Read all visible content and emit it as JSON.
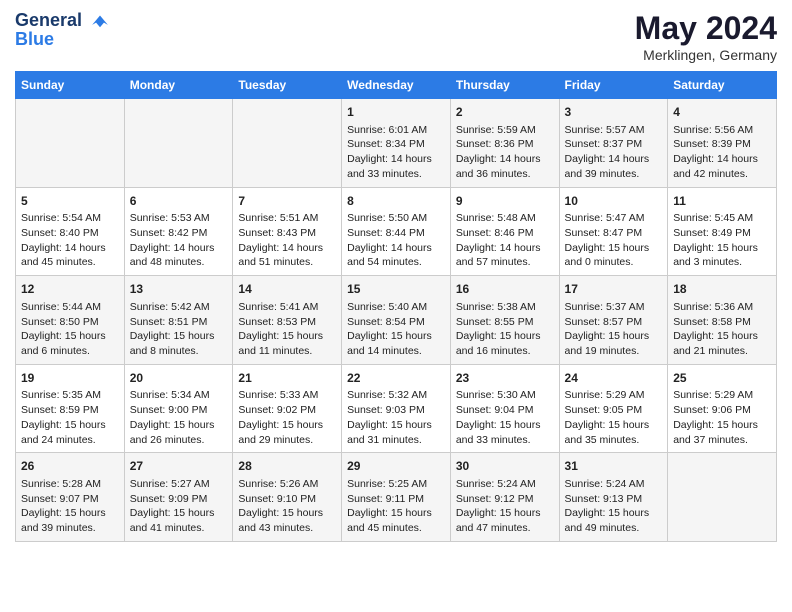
{
  "logo": {
    "line1": "General",
    "line2": "Blue"
  },
  "title": "May 2024",
  "subtitle": "Merklingen, Germany",
  "days_header": [
    "Sunday",
    "Monday",
    "Tuesday",
    "Wednesday",
    "Thursday",
    "Friday",
    "Saturday"
  ],
  "weeks": [
    [
      {
        "num": "",
        "info": ""
      },
      {
        "num": "",
        "info": ""
      },
      {
        "num": "",
        "info": ""
      },
      {
        "num": "1",
        "info": "Sunrise: 6:01 AM\nSunset: 8:34 PM\nDaylight: 14 hours and 33 minutes."
      },
      {
        "num": "2",
        "info": "Sunrise: 5:59 AM\nSunset: 8:36 PM\nDaylight: 14 hours and 36 minutes."
      },
      {
        "num": "3",
        "info": "Sunrise: 5:57 AM\nSunset: 8:37 PM\nDaylight: 14 hours and 39 minutes."
      },
      {
        "num": "4",
        "info": "Sunrise: 5:56 AM\nSunset: 8:39 PM\nDaylight: 14 hours and 42 minutes."
      }
    ],
    [
      {
        "num": "5",
        "info": "Sunrise: 5:54 AM\nSunset: 8:40 PM\nDaylight: 14 hours and 45 minutes."
      },
      {
        "num": "6",
        "info": "Sunrise: 5:53 AM\nSunset: 8:42 PM\nDaylight: 14 hours and 48 minutes."
      },
      {
        "num": "7",
        "info": "Sunrise: 5:51 AM\nSunset: 8:43 PM\nDaylight: 14 hours and 51 minutes."
      },
      {
        "num": "8",
        "info": "Sunrise: 5:50 AM\nSunset: 8:44 PM\nDaylight: 14 hours and 54 minutes."
      },
      {
        "num": "9",
        "info": "Sunrise: 5:48 AM\nSunset: 8:46 PM\nDaylight: 14 hours and 57 minutes."
      },
      {
        "num": "10",
        "info": "Sunrise: 5:47 AM\nSunset: 8:47 PM\nDaylight: 15 hours and 0 minutes."
      },
      {
        "num": "11",
        "info": "Sunrise: 5:45 AM\nSunset: 8:49 PM\nDaylight: 15 hours and 3 minutes."
      }
    ],
    [
      {
        "num": "12",
        "info": "Sunrise: 5:44 AM\nSunset: 8:50 PM\nDaylight: 15 hours and 6 minutes."
      },
      {
        "num": "13",
        "info": "Sunrise: 5:42 AM\nSunset: 8:51 PM\nDaylight: 15 hours and 8 minutes."
      },
      {
        "num": "14",
        "info": "Sunrise: 5:41 AM\nSunset: 8:53 PM\nDaylight: 15 hours and 11 minutes."
      },
      {
        "num": "15",
        "info": "Sunrise: 5:40 AM\nSunset: 8:54 PM\nDaylight: 15 hours and 14 minutes."
      },
      {
        "num": "16",
        "info": "Sunrise: 5:38 AM\nSunset: 8:55 PM\nDaylight: 15 hours and 16 minutes."
      },
      {
        "num": "17",
        "info": "Sunrise: 5:37 AM\nSunset: 8:57 PM\nDaylight: 15 hours and 19 minutes."
      },
      {
        "num": "18",
        "info": "Sunrise: 5:36 AM\nSunset: 8:58 PM\nDaylight: 15 hours and 21 minutes."
      }
    ],
    [
      {
        "num": "19",
        "info": "Sunrise: 5:35 AM\nSunset: 8:59 PM\nDaylight: 15 hours and 24 minutes."
      },
      {
        "num": "20",
        "info": "Sunrise: 5:34 AM\nSunset: 9:00 PM\nDaylight: 15 hours and 26 minutes."
      },
      {
        "num": "21",
        "info": "Sunrise: 5:33 AM\nSunset: 9:02 PM\nDaylight: 15 hours and 29 minutes."
      },
      {
        "num": "22",
        "info": "Sunrise: 5:32 AM\nSunset: 9:03 PM\nDaylight: 15 hours and 31 minutes."
      },
      {
        "num": "23",
        "info": "Sunrise: 5:30 AM\nSunset: 9:04 PM\nDaylight: 15 hours and 33 minutes."
      },
      {
        "num": "24",
        "info": "Sunrise: 5:29 AM\nSunset: 9:05 PM\nDaylight: 15 hours and 35 minutes."
      },
      {
        "num": "25",
        "info": "Sunrise: 5:29 AM\nSunset: 9:06 PM\nDaylight: 15 hours and 37 minutes."
      }
    ],
    [
      {
        "num": "26",
        "info": "Sunrise: 5:28 AM\nSunset: 9:07 PM\nDaylight: 15 hours and 39 minutes."
      },
      {
        "num": "27",
        "info": "Sunrise: 5:27 AM\nSunset: 9:09 PM\nDaylight: 15 hours and 41 minutes."
      },
      {
        "num": "28",
        "info": "Sunrise: 5:26 AM\nSunset: 9:10 PM\nDaylight: 15 hours and 43 minutes."
      },
      {
        "num": "29",
        "info": "Sunrise: 5:25 AM\nSunset: 9:11 PM\nDaylight: 15 hours and 45 minutes."
      },
      {
        "num": "30",
        "info": "Sunrise: 5:24 AM\nSunset: 9:12 PM\nDaylight: 15 hours and 47 minutes."
      },
      {
        "num": "31",
        "info": "Sunrise: 5:24 AM\nSunset: 9:13 PM\nDaylight: 15 hours and 49 minutes."
      },
      {
        "num": "",
        "info": ""
      }
    ]
  ]
}
